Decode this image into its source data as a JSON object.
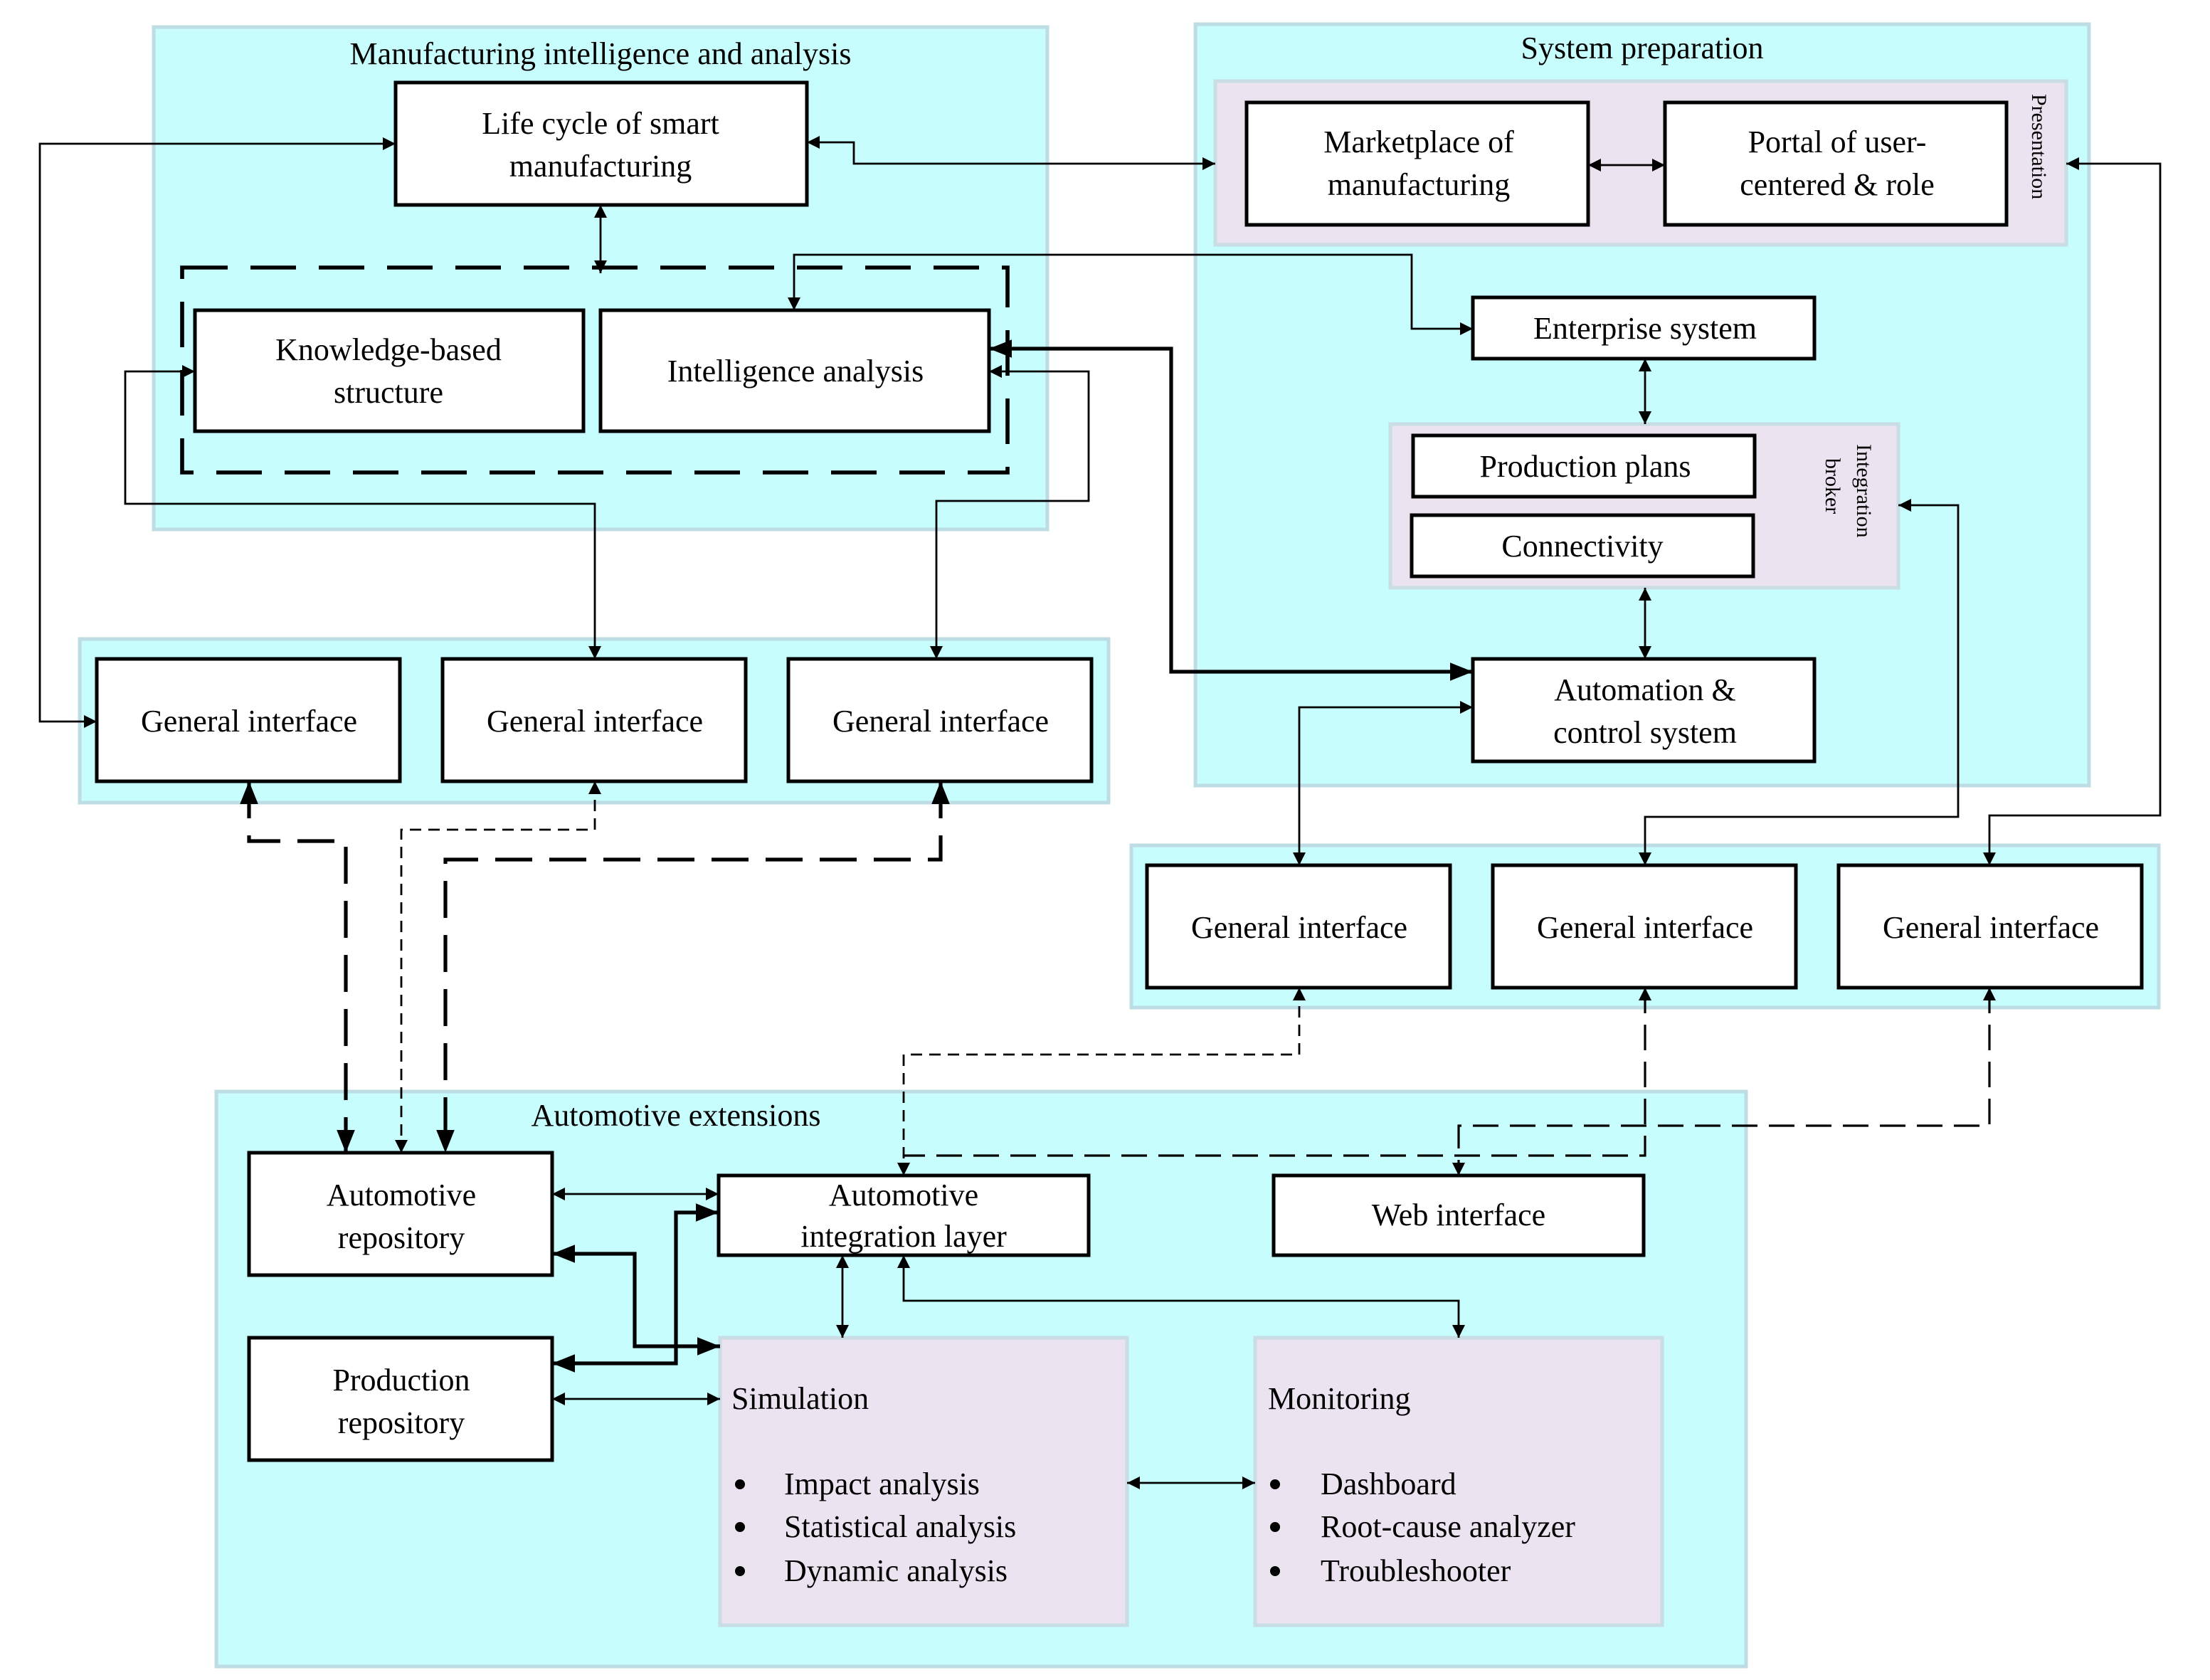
{
  "diagram": {
    "groups": {
      "manufacturing": "Manufacturing intelligence and analysis",
      "system_prep": "System preparation",
      "presentation": "Presentation",
      "integration_broker_1": "Integration",
      "integration_broker_2": "broker",
      "automotive": "Automotive extensions"
    },
    "nodes": {
      "lifecycle": [
        "Life cycle of smart",
        "manufacturing"
      ],
      "knowledge": [
        "Knowledge-based",
        "structure"
      ],
      "intelligence": [
        "Intelligence analysis"
      ],
      "gi_left_1": [
        "General interface"
      ],
      "gi_left_2": [
        "General interface"
      ],
      "gi_left_3": [
        "General interface"
      ],
      "marketplace": [
        "Marketplace of",
        "manufacturing"
      ],
      "portal": [
        "Portal of user-",
        "centered & role"
      ],
      "enterprise": [
        "Enterprise system"
      ],
      "production_plans": [
        "Production plans"
      ],
      "connectivity": [
        "Connectivity"
      ],
      "automation": [
        "Automation &",
        "control system"
      ],
      "gi_right_1": [
        "General interface"
      ],
      "gi_right_2": [
        "General interface"
      ],
      "gi_right_3": [
        "General interface"
      ],
      "auto_repo": [
        "Automotive",
        "repository"
      ],
      "auto_integration": [
        "Automotive",
        "integration layer"
      ],
      "web_interface": [
        "Web interface"
      ],
      "production_repo": [
        "Production",
        "repository"
      ]
    },
    "simulation": {
      "title": "Simulation",
      "items": [
        "Impact analysis",
        "Statistical analysis",
        "Dynamic analysis"
      ]
    },
    "monitoring": {
      "title": "Monitoring",
      "items": [
        "Dashboard",
        "Root-cause analyzer",
        "Troubleshooter"
      ]
    },
    "colors": {
      "group_fill": "#c8fdfe",
      "group_border": "#bddce3",
      "subgroup_fill": "#ebe3f0",
      "node_fill": "#ffffff",
      "line": "#000000"
    }
  }
}
